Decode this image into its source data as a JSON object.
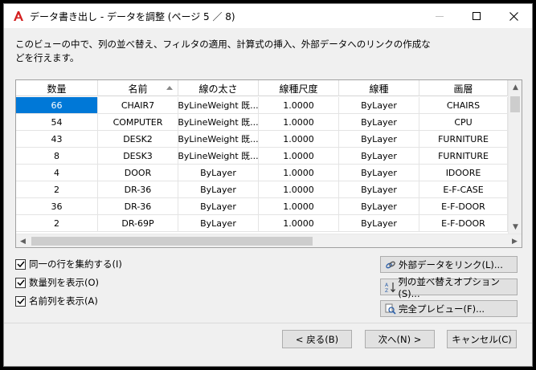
{
  "window": {
    "title": "データ書き出し - データを調整 (ページ 5 ／ 8)"
  },
  "description": "このビューの中で、列の並べ替え、フィルタの適用、計算式の挿入、外部データへのリンクの作成などを行えます。",
  "table": {
    "columns": [
      "数量",
      "名前",
      "線の太さ",
      "線種尺度",
      "線種",
      "画層"
    ],
    "sorted_column": "名前",
    "rows": [
      [
        "66",
        "CHAIR7",
        "ByLineWeight 既...",
        "1.0000",
        "ByLayer",
        "CHAIRS"
      ],
      [
        "54",
        "COMPUTER",
        "ByLineWeight 既...",
        "1.0000",
        "ByLayer",
        "CPU"
      ],
      [
        "43",
        "DESK2",
        "ByLineWeight 既...",
        "1.0000",
        "ByLayer",
        "FURNITURE"
      ],
      [
        "8",
        "DESK3",
        "ByLineWeight 既...",
        "1.0000",
        "ByLayer",
        "FURNITURE"
      ],
      [
        "4",
        "DOOR",
        "ByLayer",
        "1.0000",
        "ByLayer",
        "IDOORE"
      ],
      [
        "2",
        "DR-36",
        "ByLayer",
        "1.0000",
        "ByLayer",
        "E-F-CASE"
      ],
      [
        "36",
        "DR-36",
        "ByLayer",
        "1.0000",
        "ByLayer",
        "E-F-DOOR"
      ],
      [
        "2",
        "DR-69P",
        "ByLayer",
        "1.0000",
        "ByLayer",
        "E-F-DOOR"
      ]
    ]
  },
  "options": {
    "combine_rows": "同一の行を集約する(I)",
    "show_count": "数量列を表示(O)",
    "show_name": "名前列を表示(A)"
  },
  "side_buttons": {
    "link_external": "外部データをリンク(L)...",
    "sort_options": "列の並べ替えオプション(S)...",
    "full_preview": "完全プレビュー(F)..."
  },
  "nav_buttons": {
    "back": "< 戻る(B)",
    "next": "次へ(N) >",
    "cancel": "キャンセル(C)"
  },
  "colors": {
    "selection": "#0078d7",
    "app_icon": "#d42020"
  }
}
